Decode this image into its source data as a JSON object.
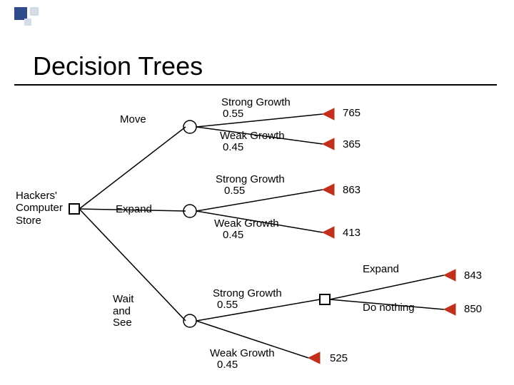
{
  "title": "Decision Trees",
  "root": "Hackers'\nComputer\nStore",
  "branches": {
    "move": "Move",
    "expand": "Expand",
    "wait": "Wait\nand\nSee"
  },
  "events": {
    "strong": "Strong Growth",
    "strong_p": "0.55",
    "weak": "Weak Growth",
    "weak_p": "0.45"
  },
  "outcomes": {
    "move_strong": "765",
    "move_weak": "365",
    "expand_strong": "863",
    "expand_weak": "413",
    "wait_strong_expand_label": "Expand",
    "wait_strong_expand_val": "843",
    "wait_strong_nothing_label": "Do nothing",
    "wait_strong_nothing_val": "850",
    "wait_weak": "525"
  },
  "chart_data": {
    "type": "tree",
    "title": "Decision Trees",
    "root": "Hackers' Computer Store",
    "decisions": [
      {
        "name": "Move",
        "chance": [
          {
            "event": "Strong Growth",
            "p": 0.55,
            "payoff": 765
          },
          {
            "event": "Weak Growth",
            "p": 0.45,
            "payoff": 365
          }
        ]
      },
      {
        "name": "Expand",
        "chance": [
          {
            "event": "Strong Growth",
            "p": 0.55,
            "payoff": 863
          },
          {
            "event": "Weak Growth",
            "p": 0.45,
            "payoff": 413
          }
        ]
      },
      {
        "name": "Wait and See",
        "chance": [
          {
            "event": "Strong Growth",
            "p": 0.55,
            "decision": [
              {
                "name": "Expand",
                "payoff": 843
              },
              {
                "name": "Do nothing",
                "payoff": 850
              }
            ]
          },
          {
            "event": "Weak Growth",
            "p": 0.45,
            "payoff": 525
          }
        ]
      }
    ]
  }
}
